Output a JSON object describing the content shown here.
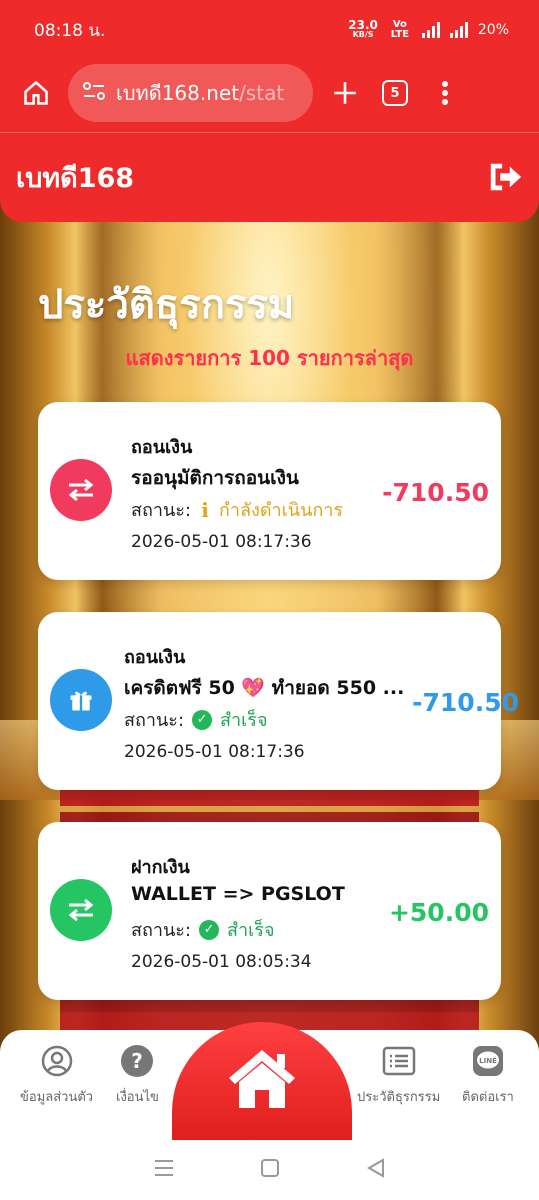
{
  "status_bar": {
    "time": "08:18 น.",
    "speed": "23.0",
    "speed_unit": "KB/S",
    "net_label": "Vo LTE",
    "battery": "20%"
  },
  "browser": {
    "url_main": "เบทดี168.net",
    "url_rest": "/stat",
    "tab_count": "5"
  },
  "app": {
    "brand": "เบทดี168",
    "heading": "ประวัติธุรกรรม",
    "subheading": "แสดงรายการ 100 รายการล่าสุด"
  },
  "transactions": [
    {
      "type": "ถอนเงิน",
      "desc": "รออนุมัติการถอนเงิน",
      "status_label": "สถานะ:",
      "status": "กำลังดำเนินการ",
      "datetime": "2026-05-01 08:17:36",
      "amount": "-710.50",
      "icon": "transfer-icon",
      "colors": {
        "circle": "#f03b5e",
        "amount": "#f03b5e",
        "status": "#e0a21a"
      }
    },
    {
      "type": "ถอนเงิน",
      "desc": "เครดิตฟรี 50 💖 ทำยอด 550 ...",
      "status_label": "สถานะ:",
      "status": "สำเร็จ",
      "datetime": "2026-05-01 08:17:36",
      "amount": "-710.50",
      "icon": "gift-icon",
      "colors": {
        "circle": "#2f9be8",
        "amount": "#2f9be8",
        "status": "#1fa653"
      }
    },
    {
      "type": "ฝากเงิน",
      "desc": "WALLET => PGSLOT",
      "status_label": "สถานะ:",
      "status": "สำเร็จ",
      "datetime": "2026-05-01 08:05:34",
      "amount": "+50.00",
      "icon": "transfer-icon",
      "colors": {
        "circle": "#24c562",
        "amount": "#24c562",
        "status": "#1fa653"
      }
    }
  ],
  "bottom_nav": {
    "profile": "ข้อมูลส่วนตัว",
    "terms": "เงื่อนไข",
    "history": "ประวัติธุรกรรม",
    "contact": "ติดต่อเรา"
  }
}
